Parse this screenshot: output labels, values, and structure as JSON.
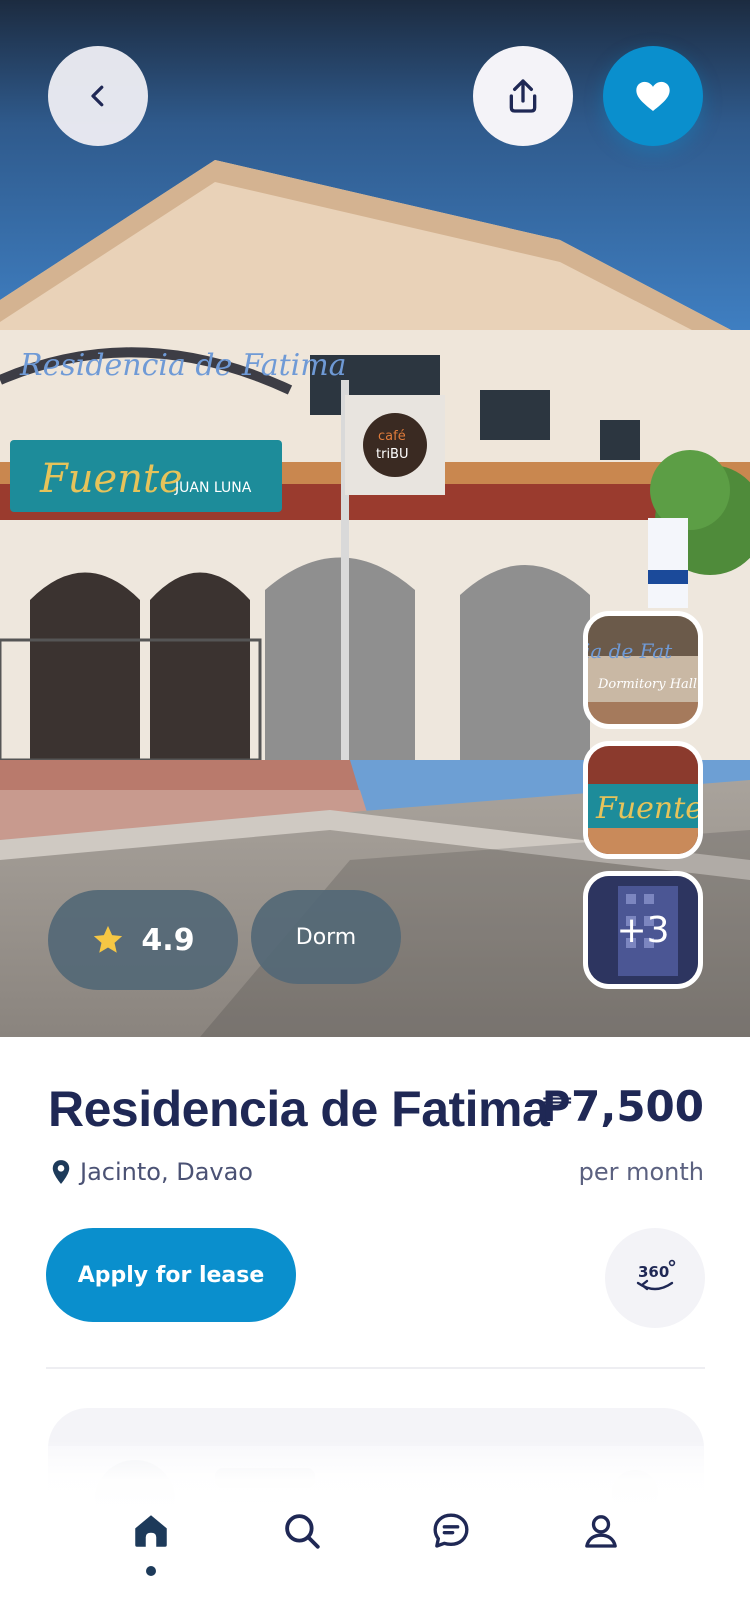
{
  "listing": {
    "name": "Residencia de Fatima",
    "price": "₱7,500",
    "price_period": "per month",
    "location": "Jacinto, Davao",
    "rating": "4.9",
    "type": "Dorm",
    "more_photos": "+3"
  },
  "actions": {
    "apply_label": "Apply for lease",
    "view_360_label": "360"
  },
  "colors": {
    "accent": "#0a8fcd",
    "text_primary": "#1f2855",
    "text_secondary": "#4b5274",
    "pill_bg": "#546876"
  },
  "icons": {
    "back": "chevron-left-icon",
    "share": "share-icon",
    "favorite": "heart-icon",
    "rating": "star-icon",
    "location": "location-pin-icon",
    "view_360": "rotate-360-icon",
    "nav": [
      "home-icon",
      "search-icon",
      "chat-icon",
      "profile-icon"
    ]
  },
  "nav": {
    "active": "home"
  }
}
